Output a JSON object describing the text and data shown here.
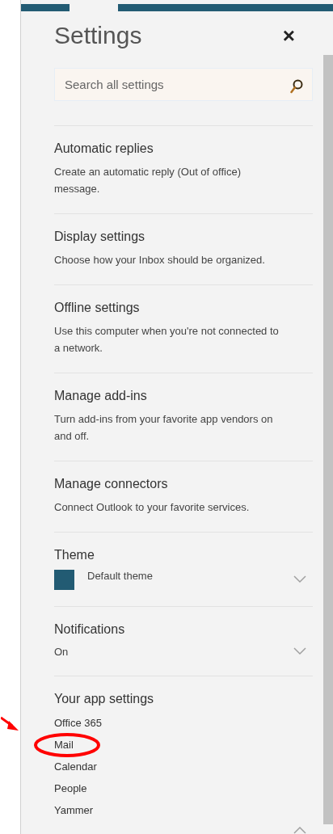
{
  "title": "Settings",
  "close": "×",
  "search": {
    "placeholder": "Search all settings"
  },
  "sections": [
    {
      "kind": "text",
      "title": "Automatic replies",
      "description": "Create an automatic reply (Out of office) message."
    },
    {
      "kind": "text",
      "title": "Display settings",
      "description": "Choose how your Inbox should be organized."
    },
    {
      "kind": "text",
      "title": "Offline settings",
      "description": "Use this computer when you're not connected to a network."
    },
    {
      "kind": "text",
      "title": "Manage add-ins",
      "description": "Turn add-ins from your favorite app vendors on and off."
    },
    {
      "kind": "text",
      "title": "Manage connectors",
      "description": "Connect Outlook to your favorite services."
    },
    {
      "kind": "theme",
      "title": "Theme",
      "value": "Default theme",
      "color": "#225b73"
    },
    {
      "kind": "select",
      "title": "Notifications",
      "value": "On"
    }
  ],
  "app_settings": {
    "title": "Your app settings",
    "items": [
      {
        "label": "Office 365",
        "circled": false
      },
      {
        "label": "Mail",
        "circled": true
      },
      {
        "label": "Calendar",
        "circled": false
      },
      {
        "label": "People",
        "circled": false
      },
      {
        "label": "Yammer",
        "circled": false
      }
    ]
  }
}
